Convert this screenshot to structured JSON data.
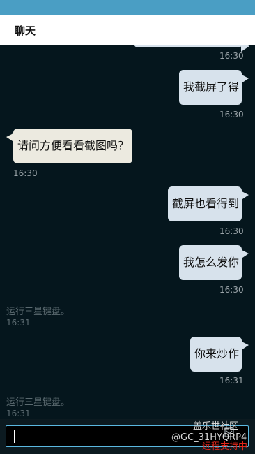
{
  "header": {
    "title": "聊天"
  },
  "messages": [
    {
      "text": "",
      "time": "16:30"
    },
    {
      "text": "我截屏了得",
      "time": "16:30"
    },
    {
      "text": "请问方便看看截图吗？",
      "time": "16:30"
    },
    {
      "text": "截屏也看得到",
      "time": "16:30"
    },
    {
      "text": "我怎么发你",
      "time": "16:30"
    },
    {
      "text": "你来炒作",
      "time": "16:31"
    }
  ],
  "system_notes": [
    {
      "text": "运行三星键盘。",
      "time": "16:31"
    },
    {
      "text": "运行三星键盘。",
      "time": "16:31"
    }
  ],
  "input": {
    "value": ""
  },
  "watermark": {
    "community": "盖乐世社区",
    "user": "@GC_31HYQRP4",
    "remote": "远程支持中"
  }
}
